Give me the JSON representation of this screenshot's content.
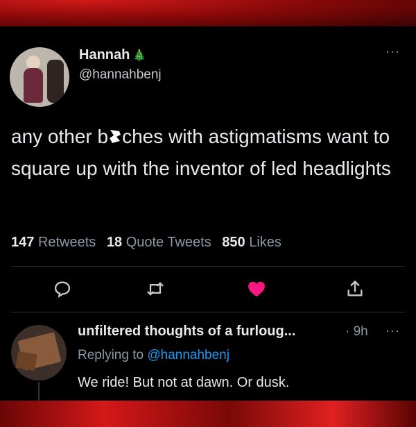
{
  "tweet": {
    "author_name": "Hannah",
    "author_emoji": "🎄",
    "handle": "@hannahbenj",
    "text_before": "any other b",
    "text_after": "ches with astigmatisms want to square up with the inventor of led headlights",
    "stats": {
      "retweets_count": "147",
      "retweets_label": "Retweets",
      "quotes_count": "18",
      "quotes_label": "Quote Tweets",
      "likes_count": "850",
      "likes_label": "Likes"
    },
    "more": "···"
  },
  "reply": {
    "author_name": "unfiltered thoughts of a furloug...",
    "time": "· 9h",
    "replying_prefix": "Replying to",
    "replying_to": "@hannahbenj",
    "text": "We ride! But not at dawn. Or dusk.",
    "more": "···"
  },
  "colors": {
    "background": "#000000",
    "text": "#e7e9ea",
    "secondary": "#8b98a5",
    "accent": "#1d9bf0",
    "like": "#f91880",
    "frame_red": "#c41414"
  },
  "icons": {
    "reply": "reply-icon",
    "retweet": "retweet-icon",
    "like": "heart-icon",
    "share": "share-icon"
  }
}
